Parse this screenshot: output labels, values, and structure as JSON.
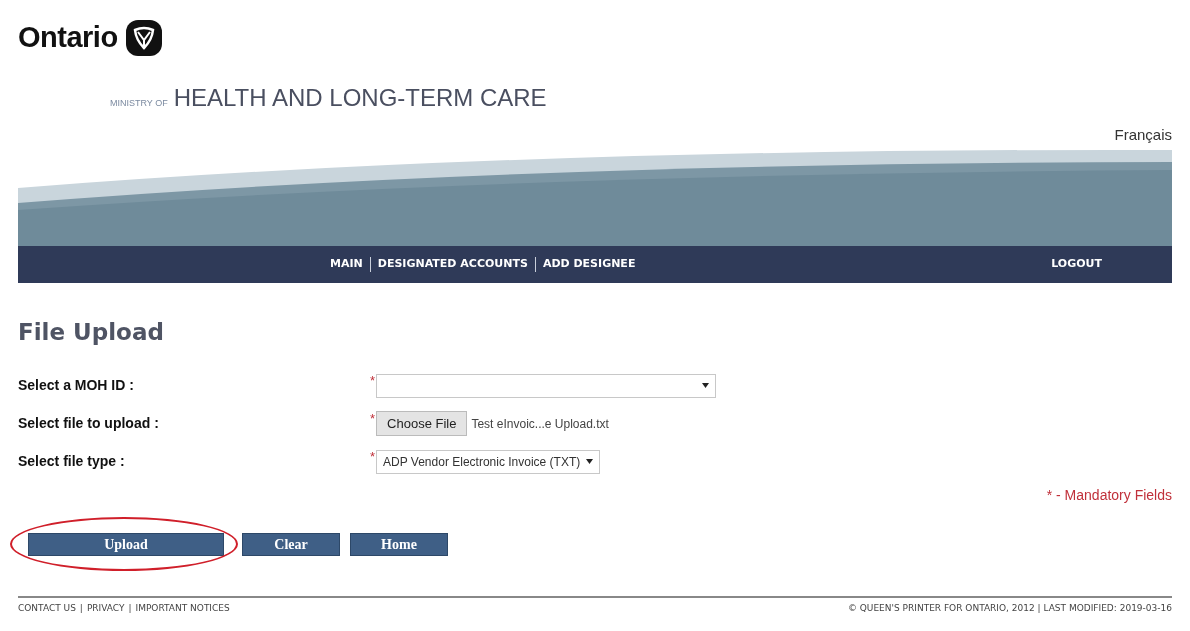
{
  "header": {
    "logo_text": "Ontario",
    "ministry_prefix": "MINISTRY OF",
    "ministry_name": "HEALTH AND LONG-TERM CARE",
    "language_link": "Français"
  },
  "nav": {
    "left_items": [
      "MAIN",
      "DESIGNATED ACCOUNTS",
      "ADD DESIGNEE"
    ],
    "right_items": [
      "LOGOUT"
    ]
  },
  "page_title": "File Upload",
  "form": {
    "fields": [
      {
        "kind": "select",
        "label": "Select a MOH ID :",
        "required_mark": "*"
      },
      {
        "kind": "file",
        "label": "Select file to upload :",
        "required_mark": "*",
        "button": "Choose File",
        "value": "Test eInvoic...e Upload.txt"
      },
      {
        "kind": "select",
        "label": "Select file type :",
        "required_mark": "*",
        "value": "ADP Vendor Electronic Invoice (TXT)"
      }
    ],
    "mandatory_note": "* - Mandatory Fields",
    "buttons": [
      {
        "label": "Upload",
        "circled": true
      },
      {
        "label": "Clear",
        "circled": false
      },
      {
        "label": "Home",
        "circled": false
      }
    ]
  },
  "footer": {
    "links": [
      "CONTACT US",
      "PRIVACY",
      "IMPORTANT NOTICES"
    ],
    "separators": [
      "|",
      "|"
    ],
    "copyright": "© QUEEN'S PRINTER FOR ONTARIO, 2012 | LAST MODIFIED: 2019-03-16"
  }
}
